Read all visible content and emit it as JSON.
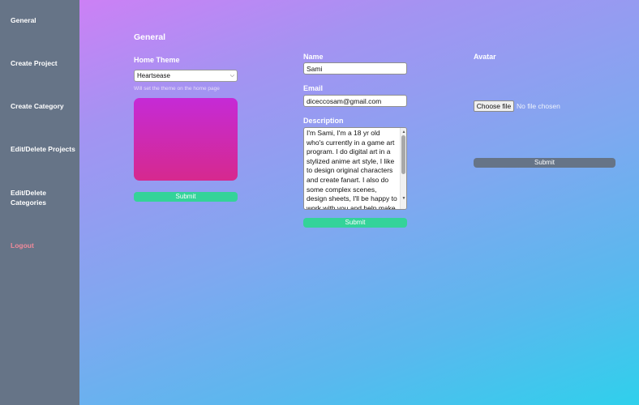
{
  "sidebar": {
    "items": [
      {
        "label": "General"
      },
      {
        "label": "Create Project"
      },
      {
        "label": "Create Category"
      },
      {
        "label": "Edit/Delete Projects"
      },
      {
        "label": "Edit/Delete Categories"
      },
      {
        "label": "Logout"
      }
    ]
  },
  "main": {
    "title": "General",
    "theme": {
      "label": "Home Theme",
      "selected": "Heartsease",
      "hint": "Will set the theme on the home page",
      "submit_label": "Submit",
      "preview_color_top": "#c52ad6",
      "preview_color_bottom": "#d6298e"
    },
    "profile": {
      "name_label": "Name",
      "name_value": "Sami",
      "email_label": "Email",
      "email_value": "diceccosam@gmail.com",
      "description_label": "Description",
      "description_value": "I'm Sami, I'm a 18 yr old who's currently in a game art program. I do digital art in a stylized anime art style, I like to design original characters and create fanart. I also do some complex scenes, design sheets, I'll be happy to work with you and help make your",
      "submit_label": "Submit"
    },
    "avatar": {
      "label": "Avatar",
      "choose_file_label": "Choose file",
      "file_status": "No file chosen",
      "submit_label": "Submit"
    }
  },
  "colors": {
    "sidebar_bg": "#667487",
    "submit_green": "#34d399",
    "submit_gray": "#667487",
    "logout_text": "#f08a9a"
  }
}
